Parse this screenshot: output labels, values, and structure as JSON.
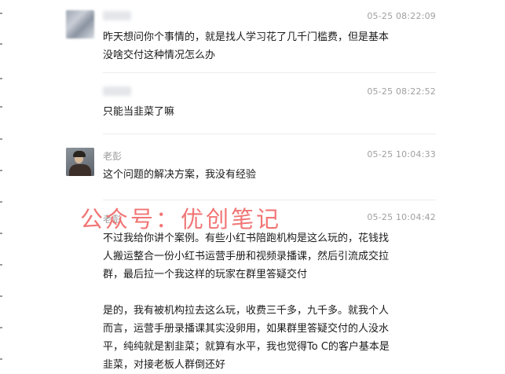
{
  "messages": [
    {
      "sender": "",
      "time": "05-25 08:22:09",
      "text": "昨天想问你个事情的，就是找人学习花了几千门槛费，但是基本\n没啥交付这种情况怎么办"
    },
    {
      "sender": "",
      "time": "05-25 08:22:52",
      "text": "只能当韭菜了嘛"
    },
    {
      "sender": "老彭",
      "time": "05-25 10:04:33",
      "text": "这个问题的解决方案，我没有经验"
    },
    {
      "sender": "老彭",
      "time": "05-25 10:04:42",
      "text": "不过我给你讲个案例。有些小红书陪跑机构是这么玩的，花钱找\n人搬运整合一份小红书运营手册和视频录播课，然后引流成交拉\n群，最后拉一个我这样的玩家在群里答疑交付\n\n是的，我有被机构拉去这么玩，收费三千多，九千多。就我个人\n而言，运营手册录播课其实没卵用，如果群里答疑交付的人没水\n平，纯纯就是割韭菜；就算有水平，我也觉得To C的客户基本是\n韭菜，对接老板人群倒还好"
    }
  ],
  "watermark": "公众号：优创笔记"
}
